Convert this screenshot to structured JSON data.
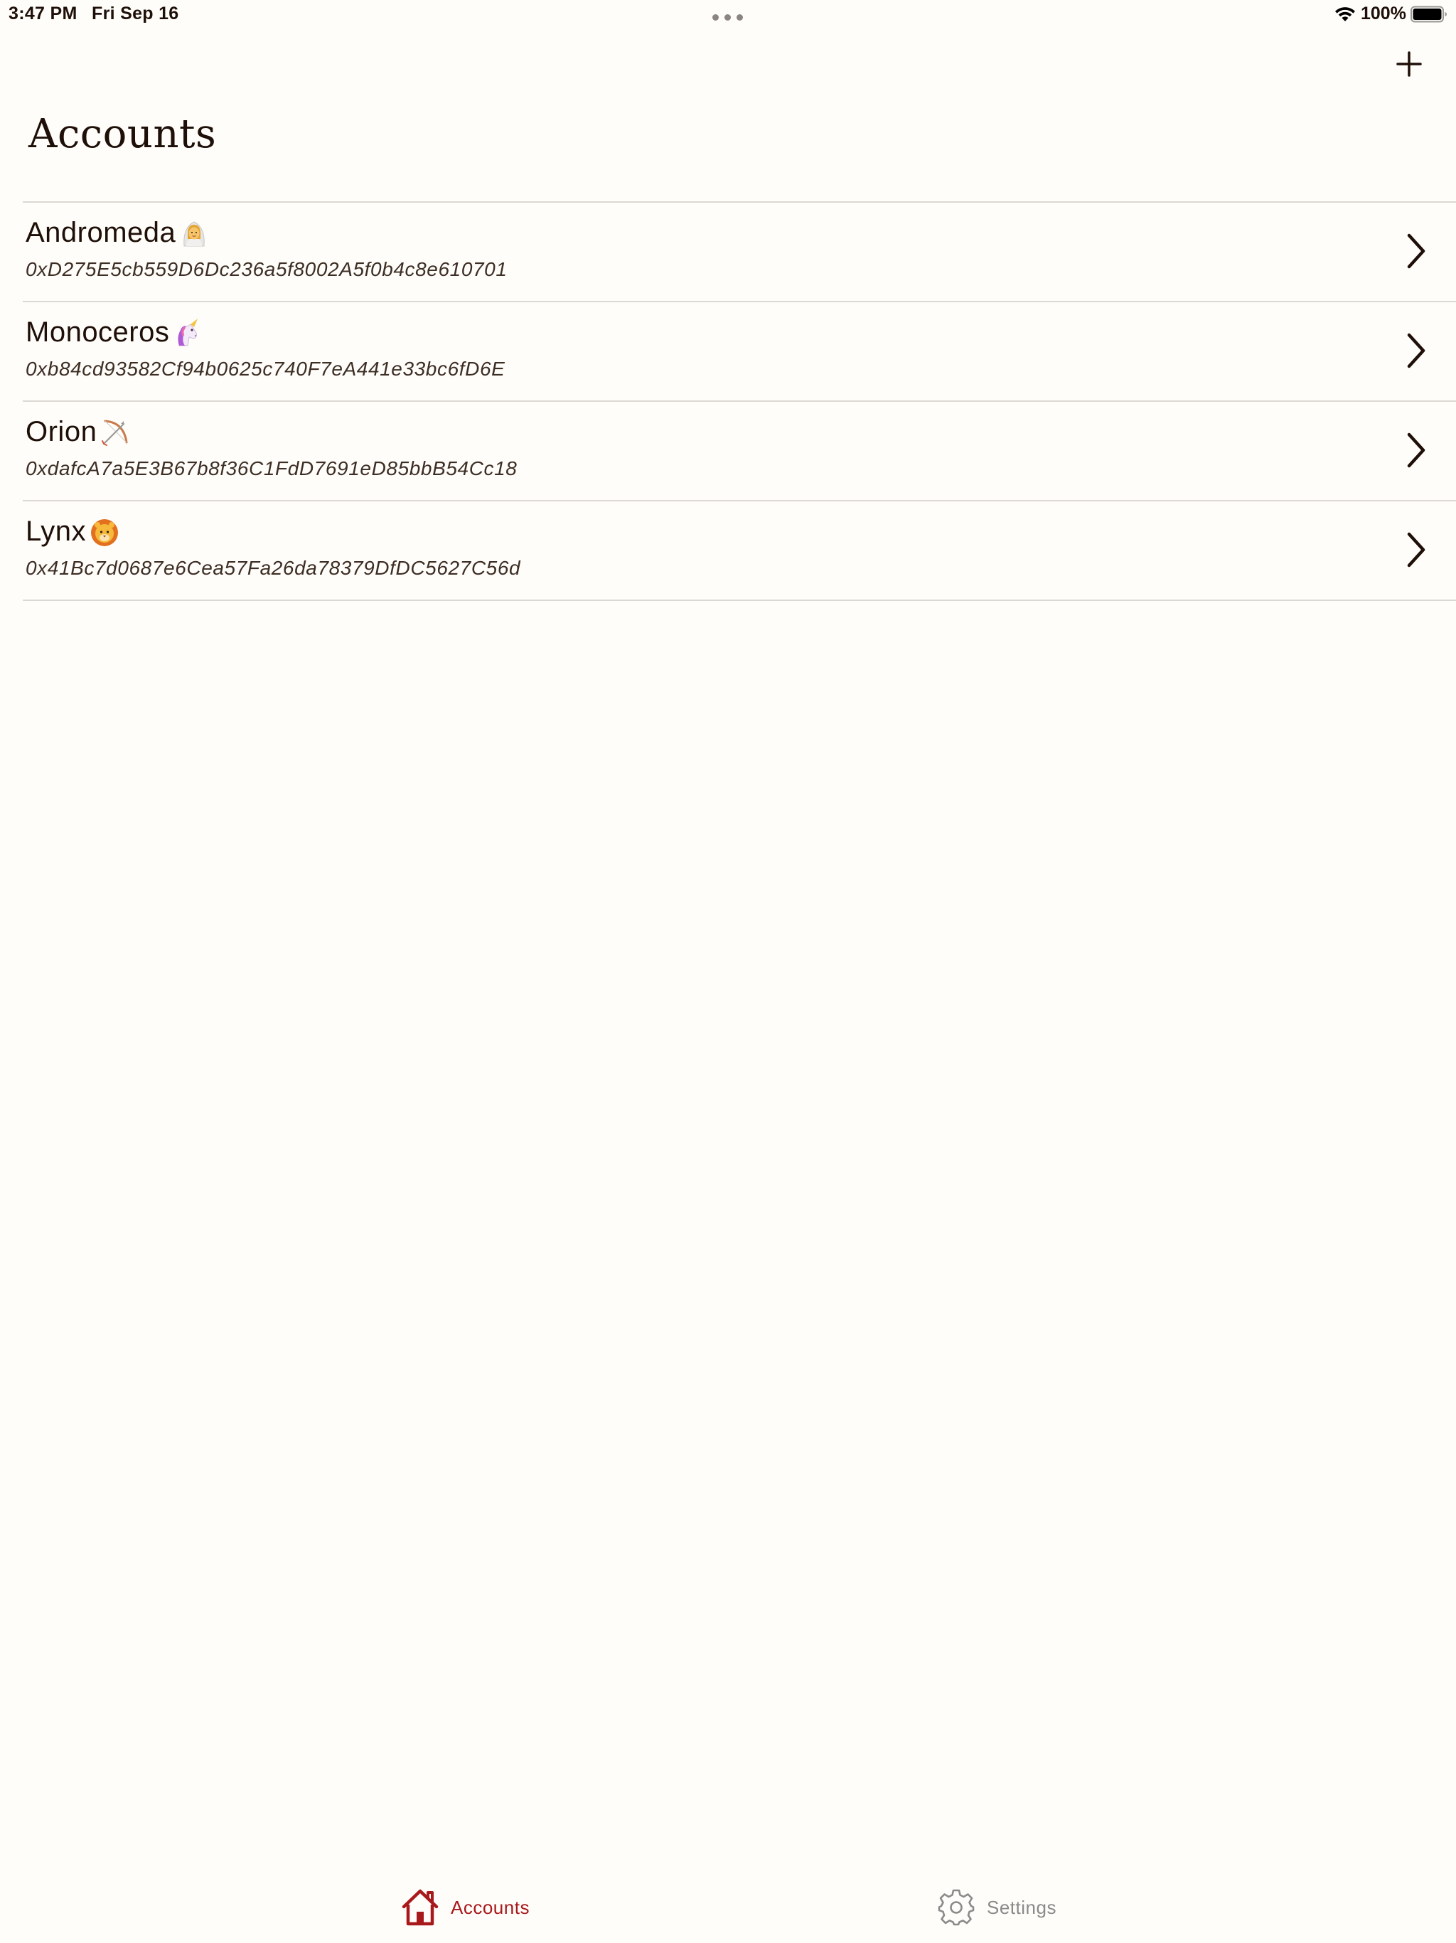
{
  "status_bar": {
    "time": "3:47 PM",
    "date": "Fri Sep 16",
    "battery": "100%"
  },
  "nav": {
    "title": "Accounts",
    "add_icon": "plus-icon"
  },
  "accounts": [
    {
      "name": "Andromeda",
      "emoji": "woman-with-veil",
      "address": "0xD275E5cb559D6Dc236a5f8002A5f0b4c8e610701"
    },
    {
      "name": "Monoceros",
      "emoji": "unicorn",
      "address": "0xb84cd93582Cf94b0625c740F7eA441e33bc6fD6E"
    },
    {
      "name": "Orion",
      "emoji": "bow-and-arrow",
      "address": "0xdafcA7a5E3B67b8f36C1FdD7691eD85bbB54Cc18"
    },
    {
      "name": "Lynx",
      "emoji": "lion",
      "address": "0x41Bc7d0687e6Cea57Fa26da78379DfDC5627C56d"
    }
  ],
  "tab_bar": {
    "accounts_label": "Accounts",
    "settings_label": "Settings"
  },
  "colors": {
    "background": "#fffdf9",
    "text": "#1e0f08",
    "accent": "#a8191c",
    "inactive": "#8a8a8a",
    "divider": "#dcd8d3"
  }
}
